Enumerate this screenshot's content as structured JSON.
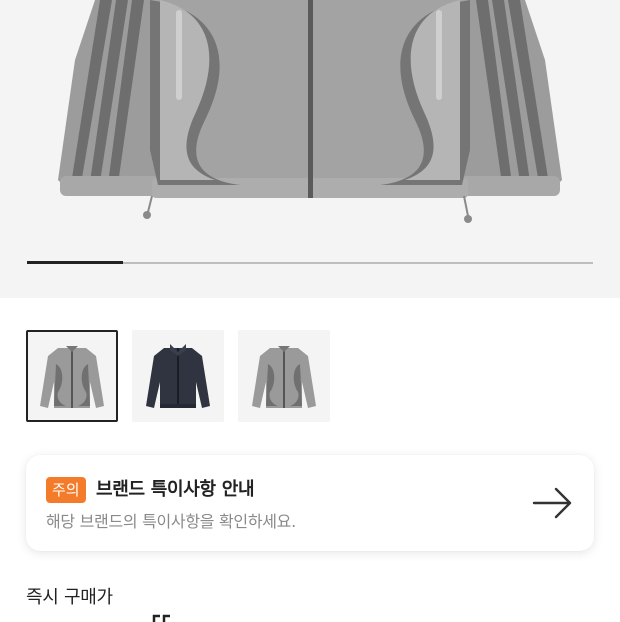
{
  "product": {
    "image_count": 3,
    "current_image_progress": 0.17,
    "image_alt": "jacket-image",
    "thumbnails": [
      {
        "name": "grey-jacket-thumb",
        "color": "#9a9a9a",
        "selected": true
      },
      {
        "name": "navy-jacket-thumb",
        "color": "#2f3440",
        "selected": false
      },
      {
        "name": "grey-jacket-thumb-2",
        "color": "#9a9a9a",
        "selected": false
      }
    ]
  },
  "notice": {
    "badge": "주의",
    "title": "브랜드 특이사항 안내",
    "description": "해당 브랜드의 특이사항을 확인하세요.",
    "icon": "arrow-right-icon",
    "badge_color": "#f47b2a"
  },
  "price": {
    "label": "즉시 구매가"
  }
}
